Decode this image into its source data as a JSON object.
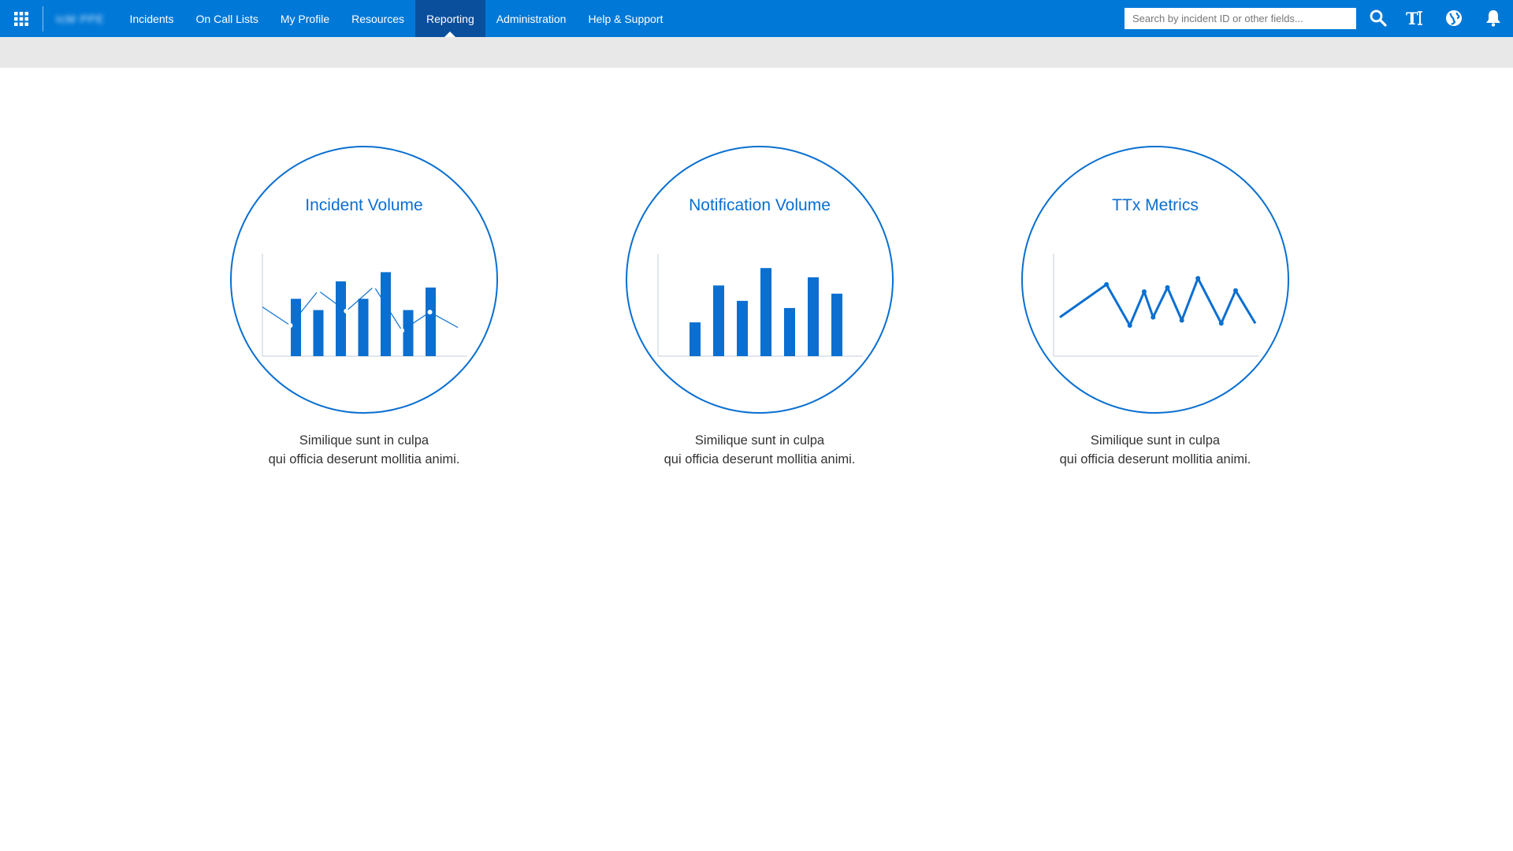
{
  "app": {
    "nav_items": [
      {
        "label": "Incidents",
        "active": false
      },
      {
        "label": "On Call Lists",
        "active": false
      },
      {
        "label": "My Profile",
        "active": false
      },
      {
        "label": "Resources",
        "active": false
      },
      {
        "label": "Reporting",
        "active": true
      },
      {
        "label": "Administration",
        "active": false
      },
      {
        "label": "Help & Support",
        "active": false
      }
    ],
    "brand_label": "IcM PPE",
    "search": {
      "placeholder": "Search by incident ID or other fields...",
      "value": ""
    },
    "icons": [
      "waffle-icon",
      "search-icon",
      "text-size-icon",
      "globe-icon",
      "bell-icon"
    ],
    "colors": {
      "brand": "#0078d7",
      "active_tab": "#0a4f9c",
      "accent": "#0a6fd1",
      "band": "#e8e8e8"
    }
  },
  "cards": [
    {
      "title": "Incident Volume",
      "line1": "Similique sunt in culpa",
      "line2": "qui officia deserunt mollitia animi."
    },
    {
      "title": "Notification Volume",
      "line1": "Similique sunt in culpa",
      "line2": "qui officia deserunt mollitia animi."
    },
    {
      "title": "TTx Metrics",
      "line1": "Similique sunt in culpa",
      "line2": "qui officia deserunt mollitia animi."
    }
  ],
  "chart_data": [
    {
      "type": "bar",
      "name": "incident-volume-icon",
      "values": [
        56,
        45,
        73,
        56,
        82,
        45,
        67
      ],
      "line_values": [
        48,
        30,
        64,
        44,
        68,
        25,
        43,
        28
      ],
      "ylim": [
        0,
        100
      ]
    },
    {
      "type": "bar",
      "name": "notification-volume-icon",
      "values": [
        33,
        69,
        54,
        86,
        47,
        77,
        61
      ],
      "ylim": [
        0,
        100
      ]
    },
    {
      "type": "line",
      "name": "ttx-metrics-icon",
      "values": [
        38,
        70,
        30,
        63,
        38,
        67,
        35,
        76,
        32,
        64,
        32
      ],
      "x": [
        0,
        26,
        39,
        47,
        52,
        60,
        68,
        77,
        90,
        98,
        109
      ],
      "ylim": [
        0,
        100
      ]
    }
  ]
}
